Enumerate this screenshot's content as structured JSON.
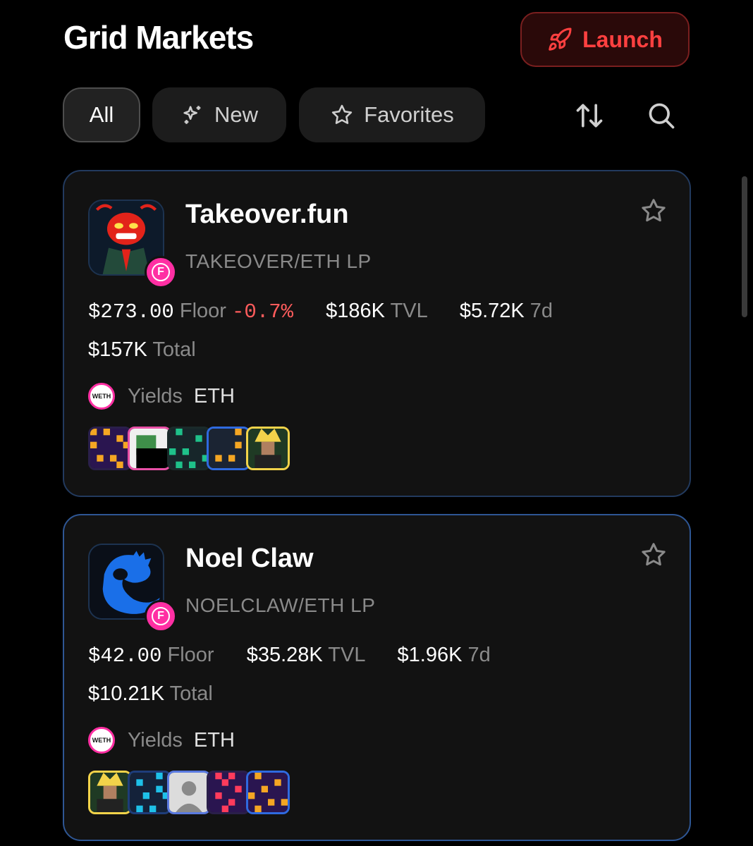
{
  "header": {
    "title": "Grid Markets",
    "launch_label": "Launch"
  },
  "filters": {
    "all": "All",
    "new": "New",
    "favorites": "Favorites"
  },
  "colors": {
    "accent_red": "#ff4040",
    "negative": "#ff5c5c",
    "card_border": "#2e5694",
    "badge_pink": "#ff2fa3"
  },
  "markets": [
    {
      "name": "Takeover.fun",
      "pair": "TAKEOVER/ETH LP",
      "floor_value": "$273.00",
      "floor_label": "Floor",
      "floor_change": "-0.7%",
      "tvl_value": "$186K",
      "tvl_label": "TVL",
      "week_value": "$5.72K",
      "week_label": "7d",
      "total_value": "$157K",
      "total_label": "Total",
      "yields_label": "Yields",
      "yields_asset": "ETH",
      "weth_icon_text": "WETH",
      "badge_letter": "F",
      "icon": "red-ant-avatar-icon"
    },
    {
      "name": "Noel Claw",
      "pair": "NOELCLAW/ETH LP",
      "floor_value": "$42.00",
      "floor_label": "Floor",
      "tvl_value": "$35.28K",
      "tvl_label": "TVL",
      "week_value": "$1.96K",
      "week_label": "7d",
      "total_value": "$10.21K",
      "total_label": "Total",
      "yields_label": "Yields",
      "yields_asset": "ETH",
      "weth_icon_text": "WETH",
      "badge_letter": "F",
      "icon": "blue-claw-avatar-icon"
    }
  ]
}
